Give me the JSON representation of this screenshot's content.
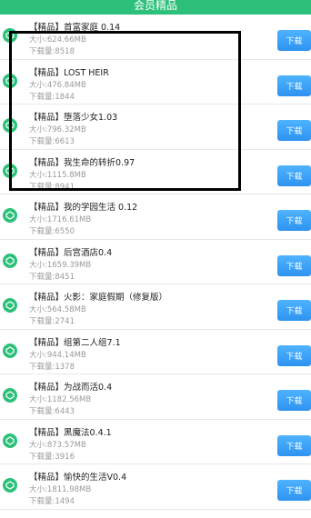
{
  "header": {
    "title": "会员精品"
  },
  "colors": {
    "accent": "#2cc07a",
    "button": "#3aa3f7",
    "highlight": "#000000"
  },
  "items": [
    {
      "title": "【精品】首富家庭 0.14",
      "size": "大小:624.66MB",
      "downloads": "下载量:8518",
      "button": "下载"
    },
    {
      "title": "【精品】LOST HEIR",
      "size": "大小:476.84MB",
      "downloads": "下载量:1844",
      "button": "下载"
    },
    {
      "title": "【精品】堕落少女1.03",
      "size": "大小:796.32MB",
      "downloads": "下载量:6613",
      "button": "下载"
    },
    {
      "title": "【精品】我生命的转折0.97",
      "size": "大小:1115.8MB",
      "downloads": "下载量:8941",
      "button": "下载"
    },
    {
      "title": "【精品】我的学园生活 0.12",
      "size": "大小:1716.61MB",
      "downloads": "下载量:6550",
      "button": "下载"
    },
    {
      "title": "【精品】后宫酒店0.4",
      "size": "大小:1659.39MB",
      "downloads": "下载量:8451",
      "button": "下载"
    },
    {
      "title": "【精品】火影：家庭假期（修复版）",
      "size": "大小:564.58MB",
      "downloads": "下载量:2741",
      "button": "下载"
    },
    {
      "title": "【精品】组第二人组7.1",
      "size": "大小:944.14MB",
      "downloads": "下载量:1378",
      "button": "下载"
    },
    {
      "title": "【精品】为战而活0.4",
      "size": "大小:1182.56MB",
      "downloads": "下载量:6443",
      "button": "下载"
    },
    {
      "title": "【精品】黑魔法0.4.1",
      "size": "大小:873.57MB",
      "downloads": "下载量:3916",
      "button": "下载"
    },
    {
      "title": "【精品】愉快的生活V0.4",
      "size": "大小:1811.98MB",
      "downloads": "下载量:1494",
      "button": "下载"
    }
  ]
}
